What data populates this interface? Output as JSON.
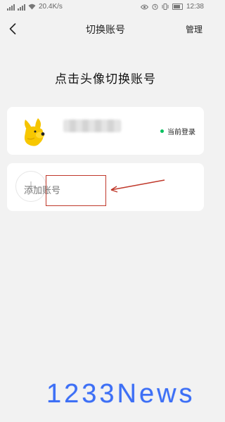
{
  "status_bar": {
    "signal_1": "4G",
    "signal_2": "4G",
    "speed": "20.4K/s",
    "time": "12:38"
  },
  "nav": {
    "title": "切换账号",
    "manage_label": "管理",
    "back_icon": "chevron-left-icon"
  },
  "heading": "点击头像切换账号",
  "current_account": {
    "status_label": "当前登录",
    "status_color": "#07c160",
    "avatar_icon": "yellow-cartoon-avatar"
  },
  "add_account": {
    "label": "添加账号",
    "icon": "plus-icon",
    "highlight_color": "#c0392b"
  },
  "watermark": {
    "text": "1233News",
    "color": "#3d6ff5"
  }
}
